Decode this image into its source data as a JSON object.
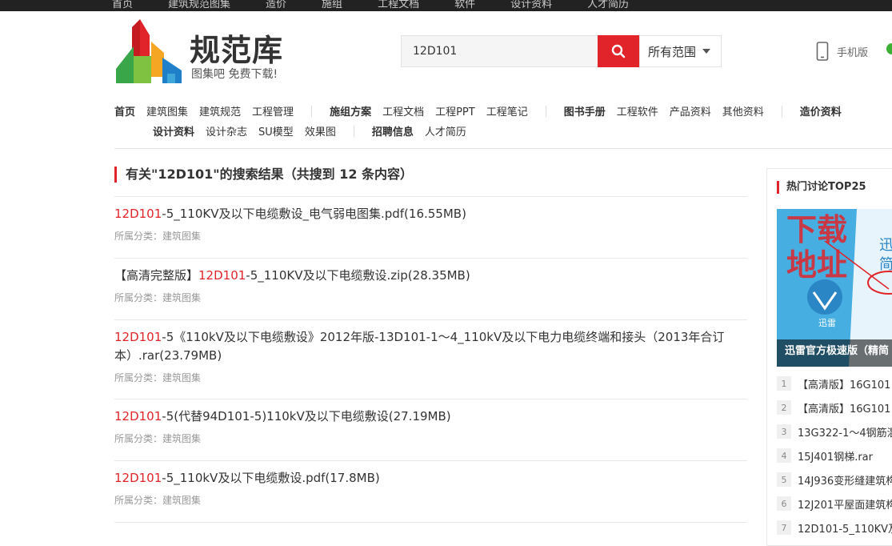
{
  "top_bar": {
    "links": [
      "首页",
      "建筑规范图集",
      "造价",
      "施组",
      "工程文档",
      "软件",
      "设计资料",
      "人才简历"
    ]
  },
  "logo": {
    "name": "规范库",
    "slogan": "图集吧 免费下载!"
  },
  "search": {
    "value": "12D101",
    "scope": "所有范围"
  },
  "header_right": {
    "mobile_label": "手机版"
  },
  "nav": {
    "row1": [
      {
        "label": "首页",
        "bold": true
      },
      {
        "label": "建筑图集"
      },
      {
        "label": "建筑规范"
      },
      {
        "label": "工程管理"
      },
      {
        "sep": true
      },
      {
        "label": "施组方案",
        "bold": true
      },
      {
        "label": "工程文档"
      },
      {
        "label": "工程PPT"
      },
      {
        "label": "工程笔记"
      },
      {
        "sep": true
      },
      {
        "label": "图书手册",
        "bold": true
      },
      {
        "label": "工程软件"
      },
      {
        "label": "产品资料"
      },
      {
        "label": "其他资料"
      },
      {
        "sep": true
      },
      {
        "label": "造价资料",
        "bold": true
      }
    ],
    "row2": [
      {
        "label": "设计资料",
        "bold": true
      },
      {
        "label": "设计杂志"
      },
      {
        "label": "SU模型"
      },
      {
        "label": "效果图"
      },
      {
        "sep": true
      },
      {
        "label": "招聘信息",
        "bold": true
      },
      {
        "label": "人才简历"
      }
    ]
  },
  "results": {
    "heading_prefix": "有关\"12D101\"的搜索结果（共搜到 ",
    "count": "12",
    "heading_suffix": " 条内容）",
    "category_label": "所属分类：",
    "items": [
      {
        "pre": "",
        "hl": "12D101",
        "post": "-5_110KV及以下电缆敷设_电气弱电图集.pdf(16.55MB)",
        "category": "建筑图集"
      },
      {
        "pre": "【高清完整版】",
        "hl": "12D101",
        "post": "-5_110KV及以下电缆敷设.zip(28.35MB)",
        "category": "建筑图集"
      },
      {
        "pre": "",
        "hl": "12D101",
        "post": "-5《110kV及以下电缆敷设》2012年版-13D101-1～4_110kV及以下电力电缆终端和接头（2013年合订本）.rar(23.79MB)",
        "category": "建筑图集"
      },
      {
        "pre": "",
        "hl": "12D101",
        "post": "-5(代替94D101-5)110kV及以下电缆敷设(27.19MB)",
        "category": "建筑图集"
      },
      {
        "pre": "",
        "hl": "12D101",
        "post": "-5_110kV及以下电缆敷设.pdf(17.8MB)",
        "category": "建筑图集"
      }
    ]
  },
  "sidebar": {
    "title": "热门讨论TOP25",
    "banner": {
      "caption": "迅雷官方极速版（精简",
      "handwriting": "下载地址",
      "side_text": "迅 简",
      "badge": "迅雷"
    },
    "top_items": [
      {
        "num": "1",
        "text": "【高清版】16G101"
      },
      {
        "num": "2",
        "text": "【高清版】16G101"
      },
      {
        "num": "3",
        "text": "13G322-1～4钢筋混"
      },
      {
        "num": "4",
        "text": "15J401钢梯.rar"
      },
      {
        "num": "5",
        "text": "14J936变形缝建筑构"
      },
      {
        "num": "6",
        "text": "12J201平屋面建筑构"
      },
      {
        "num": "7",
        "text": "12D101-5_110KV及"
      }
    ]
  },
  "colors": {
    "accent": "#e0242a",
    "text": "#333333",
    "muted": "#999999"
  }
}
